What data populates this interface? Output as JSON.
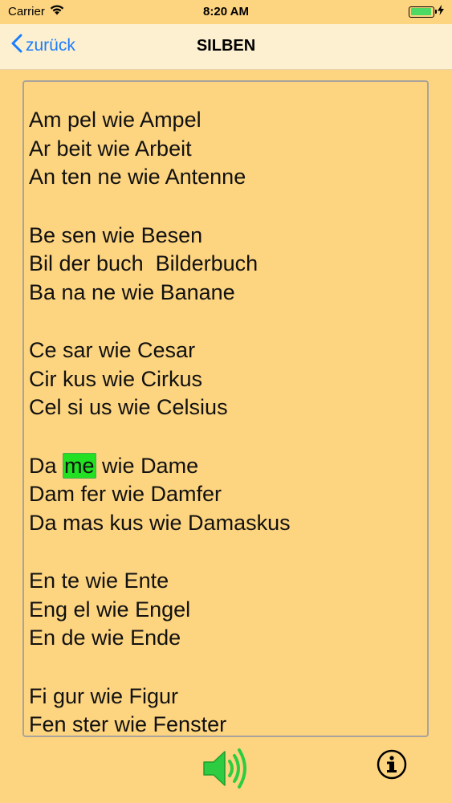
{
  "status_bar": {
    "carrier": "Carrier",
    "time": "8:20 AM"
  },
  "nav": {
    "back_label": "zurück",
    "title": "SILBEN"
  },
  "groups": [
    {
      "lines": [
        {
          "pre": "Am pel wie Ampel",
          "hl": "",
          "post": ""
        },
        {
          "pre": "Ar beit wie Arbeit",
          "hl": "",
          "post": ""
        },
        {
          "pre": "An ten ne wie Antenne",
          "hl": "",
          "post": ""
        }
      ]
    },
    {
      "lines": [
        {
          "pre": "Be sen wie Besen",
          "hl": "",
          "post": ""
        },
        {
          "pre": "Bil der buch  Bilderbuch",
          "hl": "",
          "post": ""
        },
        {
          "pre": "Ba na ne wie Banane",
          "hl": "",
          "post": ""
        }
      ]
    },
    {
      "lines": [
        {
          "pre": "Ce sar wie Cesar",
          "hl": "",
          "post": ""
        },
        {
          "pre": "Cir kus wie Cirkus",
          "hl": "",
          "post": ""
        },
        {
          "pre": "Cel si us wie Celsius",
          "hl": "",
          "post": ""
        }
      ]
    },
    {
      "lines": [
        {
          "pre": "Da ",
          "hl": "me",
          "post": " wie Dame"
        },
        {
          "pre": "Dam fer wie Damfer",
          "hl": "",
          "post": ""
        },
        {
          "pre": "Da mas kus wie Damaskus",
          "hl": "",
          "post": ""
        }
      ]
    },
    {
      "lines": [
        {
          "pre": "En te wie Ente",
          "hl": "",
          "post": ""
        },
        {
          "pre": "Eng el wie Engel",
          "hl": "",
          "post": ""
        },
        {
          "pre": "En de wie Ende",
          "hl": "",
          "post": ""
        }
      ]
    },
    {
      "lines": [
        {
          "pre": "Fi gur wie Figur",
          "hl": "",
          "post": ""
        },
        {
          "pre": "Fen ster wie Fenster",
          "hl": "",
          "post": ""
        }
      ]
    }
  ],
  "colors": {
    "background": "#fdd47f",
    "nav_background": "#fdf0d0",
    "accent": "#1a7cff",
    "highlight": "#22e022",
    "speaker": "#2ecc40"
  },
  "icons": {
    "speaker": "speaker-icon",
    "info": "info-icon",
    "back": "chevron-left-icon"
  }
}
